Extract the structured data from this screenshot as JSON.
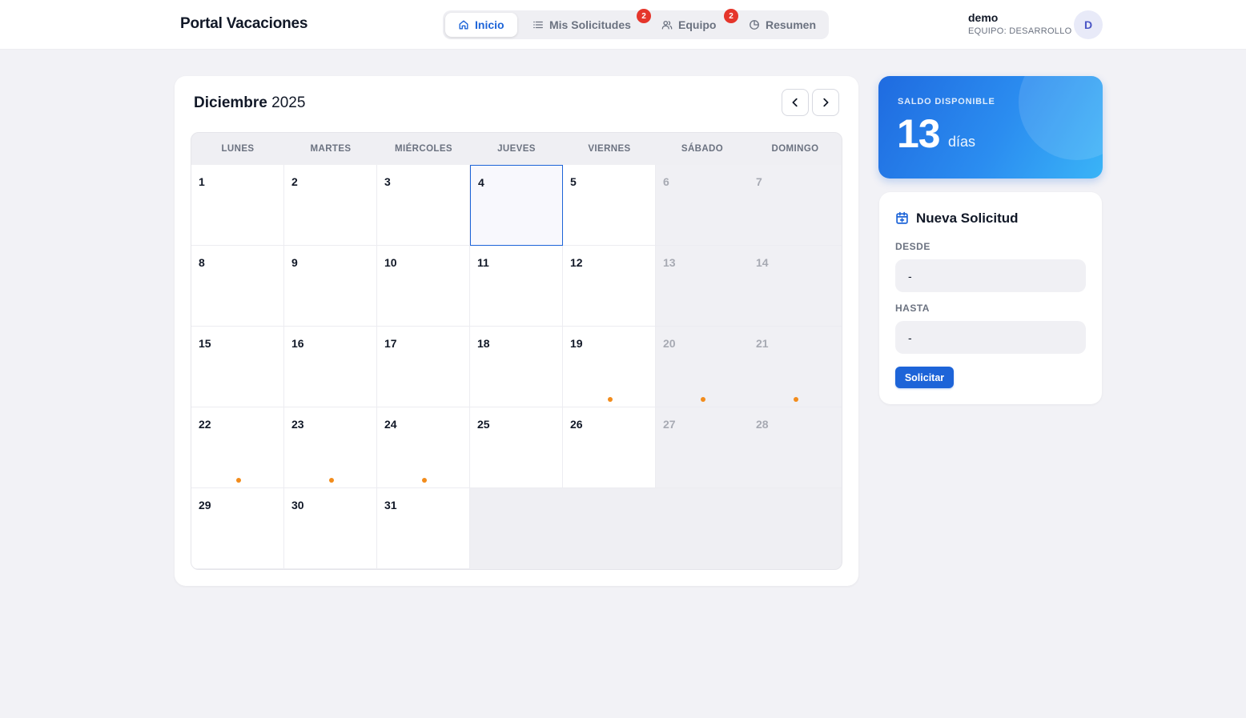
{
  "app": {
    "title": "Portal Vacaciones"
  },
  "nav": {
    "items": [
      {
        "label": "Inicio",
        "icon": "home-icon",
        "active": true
      },
      {
        "label": "Mis Solicitudes",
        "icon": "list-icon",
        "badge": "2"
      },
      {
        "label": "Equipo",
        "icon": "users-icon",
        "badge": "2"
      },
      {
        "label": "Resumen",
        "icon": "pie-chart-icon"
      }
    ]
  },
  "user": {
    "name": "demo",
    "team": "EQUIPO: DESARROLLO",
    "initial": "D"
  },
  "calendar": {
    "month": "Diciembre",
    "year": "2025",
    "weekdays": [
      "LUNES",
      "MARTES",
      "MIÉRCOLES",
      "JUEVES",
      "VIERNES",
      "SÁBADO",
      "DOMINGO"
    ],
    "days": [
      "1",
      "2",
      "3",
      "4",
      "5",
      "6",
      "7",
      "8",
      "9",
      "10",
      "11",
      "12",
      "13",
      "14",
      "15",
      "16",
      "17",
      "18",
      "19",
      "20",
      "21",
      "22",
      "23",
      "24",
      "25",
      "26",
      "27",
      "28",
      "29",
      "30",
      "31"
    ],
    "today": "4",
    "marked_days": [
      "19",
      "20",
      "21",
      "22",
      "23",
      "24"
    ],
    "marker_color": "#f28c1c"
  },
  "balance": {
    "label": "SALDO DISPONIBLE",
    "value": "13",
    "unit": "días"
  },
  "request_form": {
    "title": "Nueva Solicitud",
    "from_label": "DESDE",
    "from_value": "-",
    "to_label": "HASTA",
    "to_value": "-",
    "submit_label": "Solicitar"
  },
  "colors": {
    "accent": "#1d64d8",
    "badge": "#e5352b",
    "background": "#f2f2f6"
  }
}
